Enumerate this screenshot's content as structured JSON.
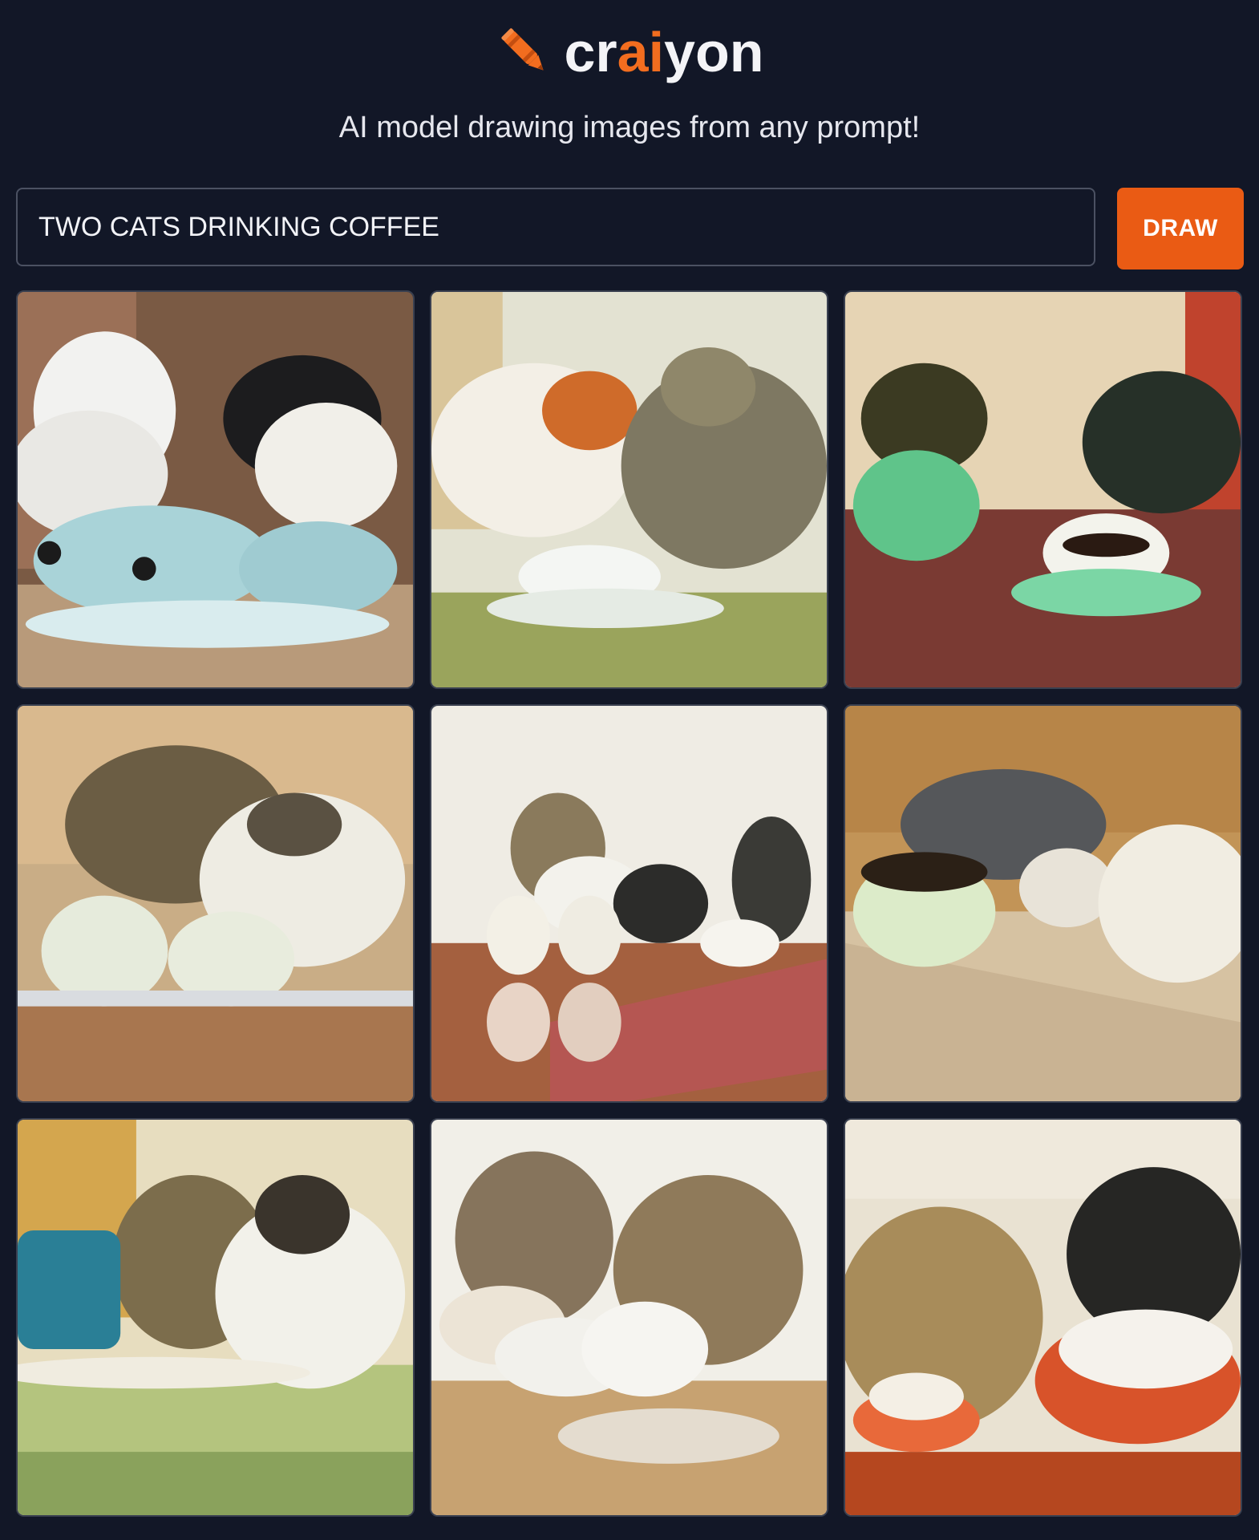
{
  "brand": {
    "prefix": "cr",
    "accent": "ai",
    "suffix": "yon",
    "accent_color": "#f26d1f"
  },
  "tagline": "AI model drawing images from any prompt!",
  "prompt": {
    "value": "TWO CATS DRINKING COFFEE"
  },
  "draw_button": {
    "label": "DRAW",
    "color": "#ea5b14"
  },
  "icons": {
    "logo": "pencil-crayon-icon"
  },
  "images": [
    {
      "subject": "two cats with teal cups"
    },
    {
      "subject": "calico and tabby with white cup"
    },
    {
      "subject": "dark cats with green cups"
    },
    {
      "subject": "tabby and white cat with two cups"
    },
    {
      "subject": "cats with white cups on red table"
    },
    {
      "subject": "grey and cream cats with green bowl"
    },
    {
      "subject": "tabby and white cat with blue cup"
    },
    {
      "subject": "two tabbies with white cups"
    },
    {
      "subject": "orange and black cats with orange bowl"
    }
  ]
}
